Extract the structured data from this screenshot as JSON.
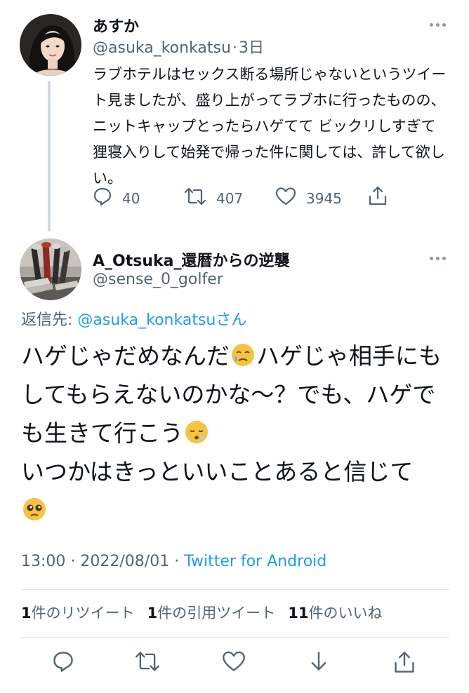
{
  "tweet1": {
    "author_name": "あすか",
    "handle": "@asuka_konkatsu",
    "separator": "·",
    "time": "3日",
    "text": "ラブホテルはセックス断る場所じゃないというツイート見ましたが、盛り上がってラブホに行ったものの、ニットキャップとったらハゲてて ビックリしすぎて狸寝入りして始発で帰った件に関しては、許して欲しい。",
    "reply_count": "40",
    "retweet_count": "407",
    "like_count": "3945"
  },
  "tweet2": {
    "author_name": "A_Otsuka_還暦からの逆襲",
    "handle": "@sense_0_golfer",
    "reply_to_label": "返信先:",
    "reply_to_handle": "@asuka_konkatsu",
    "reply_to_suffix": "さん",
    "text_part1": "ハゲじゃだめなんだ",
    "text_part2": "ハゲじゃ相手にもしてもらえないのかな～？でも、ハゲでも生きて行こう",
    "text_part3": "いつかはきっといいことあると信じて",
    "time": "13:00",
    "date": "2022/08/01",
    "meta_separator": "·",
    "source": "Twitter for Android",
    "retweets_num": "1",
    "retweets_label": "件のリツイート",
    "quotes_num": "1",
    "quotes_label": "件の引用ツイート",
    "likes_num": "11",
    "likes_label": "件のいいね"
  },
  "colors": {
    "text": "#0f1419",
    "secondary": "#536471",
    "link": "#1d9bf0",
    "line": "#cfd9de"
  },
  "icons": [
    "reply-icon",
    "retweet-icon",
    "like-icon",
    "share-icon",
    "download-icon",
    "more-icon"
  ]
}
